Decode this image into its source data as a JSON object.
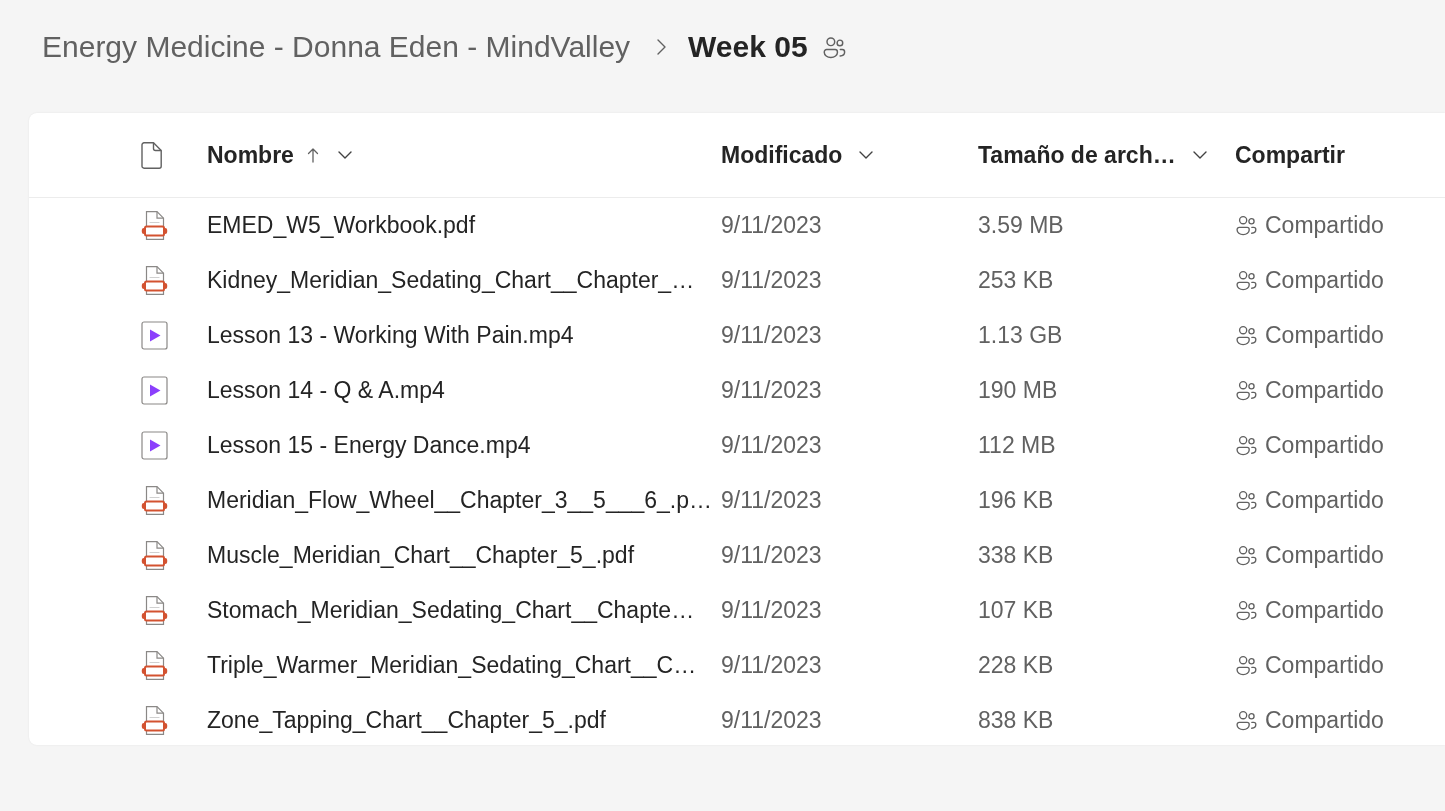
{
  "breadcrumb": {
    "items": [
      {
        "label": "Energy Medicine - Donna Eden - MindValley",
        "current": false,
        "shared": false
      },
      {
        "label": "Week 05",
        "current": true,
        "shared": true
      }
    ]
  },
  "table": {
    "columns": [
      {
        "label": "Nombre",
        "sorted_ascending": true,
        "menu": true
      },
      {
        "label": "Modificado",
        "sorted_ascending": false,
        "menu": true
      },
      {
        "label": "Tamaño de arch…",
        "sorted_ascending": false,
        "menu": true
      },
      {
        "label": "Compartir",
        "sorted_ascending": false,
        "menu": false
      }
    ],
    "rows": [
      {
        "kind": "pdf",
        "name": "EMED_W5_Workbook.pdf",
        "modified": "9/11/2023",
        "size": "3.59 MB",
        "sharing": "Compartido"
      },
      {
        "kind": "pdf",
        "name": "Kidney_Meridian_Sedating_Chart__Chapter_…",
        "modified": "9/11/2023",
        "size": "253 KB",
        "sharing": "Compartido"
      },
      {
        "kind": "video",
        "name": "Lesson 13 - Working With Pain.mp4",
        "modified": "9/11/2023",
        "size": "1.13 GB",
        "sharing": "Compartido"
      },
      {
        "kind": "video",
        "name": "Lesson 14 - Q & A.mp4",
        "modified": "9/11/2023",
        "size": "190 MB",
        "sharing": "Compartido"
      },
      {
        "kind": "video",
        "name": "Lesson 15 - Energy Dance.mp4",
        "modified": "9/11/2023",
        "size": "112 MB",
        "sharing": "Compartido"
      },
      {
        "kind": "pdf",
        "name": "Meridian_Flow_Wheel__Chapter_3__5___6_.p…",
        "modified": "9/11/2023",
        "size": "196 KB",
        "sharing": "Compartido"
      },
      {
        "kind": "pdf",
        "name": "Muscle_Meridian_Chart__Chapter_5_.pdf",
        "modified": "9/11/2023",
        "size": "338 KB",
        "sharing": "Compartido"
      },
      {
        "kind": "pdf",
        "name": "Stomach_Meridian_Sedating_Chart__Chapte…",
        "modified": "9/11/2023",
        "size": "107 KB",
        "sharing": "Compartido"
      },
      {
        "kind": "pdf",
        "name": "Triple_Warmer_Meridian_Sedating_Chart__C…",
        "modified": "9/11/2023",
        "size": "228 KB",
        "sharing": "Compartido"
      },
      {
        "kind": "pdf",
        "name": "Zone_Tapping_Chart__Chapter_5_.pdf",
        "modified": "9/11/2023",
        "size": "838 KB",
        "sharing": "Compartido"
      }
    ]
  }
}
